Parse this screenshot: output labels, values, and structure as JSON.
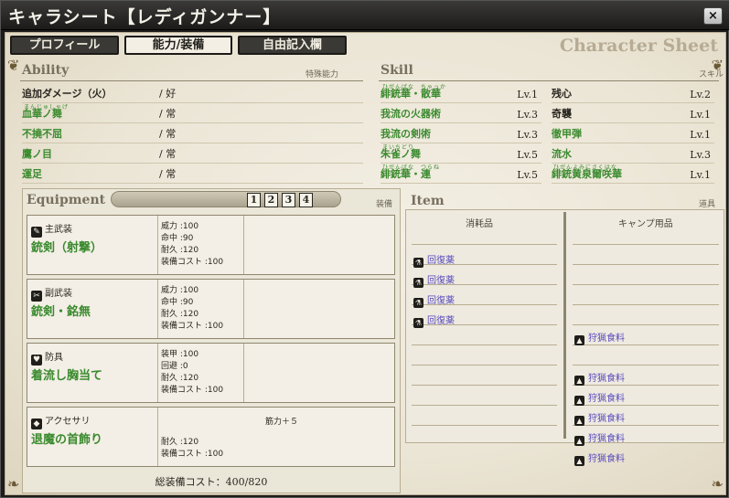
{
  "window": {
    "title": "キャラシート【レディガンナー】",
    "close": "×"
  },
  "tabs": [
    {
      "label": "プロフィール"
    },
    {
      "label": "能力/装備"
    },
    {
      "label": "自由記入欄"
    }
  ],
  "sheet_label": "Character Sheet",
  "ability": {
    "header": "Ability",
    "header_right": "特殊能力",
    "rows": [
      {
        "name": "追加ダメージ（火）",
        "ruby": "",
        "value": "/ 好"
      },
      {
        "name": "血華ノ舞",
        "ruby": "まんじゅしゃげ",
        "value": "/ 常"
      },
      {
        "name": "不撓不屈",
        "ruby": "",
        "value": "/ 常"
      },
      {
        "name": "鷹ノ目",
        "ruby": "",
        "value": "/ 常"
      },
      {
        "name": "運足",
        "ruby": "",
        "value": "/ 常"
      }
    ]
  },
  "skill": {
    "header": "Skill",
    "header_right": "スキル",
    "rows": [
      {
        "left": {
          "name": "緋銃華・散華",
          "ruby": "ひがんばな　ちゃっか",
          "lv": "Lv.1"
        },
        "right": {
          "name": "残心",
          "ruby": "",
          "lv": "Lv.2"
        }
      },
      {
        "left": {
          "name": "我流の火器術",
          "ruby": "",
          "lv": "Lv.3"
        },
        "right": {
          "name": "奇襲",
          "ruby": "",
          "lv": "Lv.1"
        }
      },
      {
        "left": {
          "name": "我流の剣術",
          "ruby": "",
          "lv": "Lv.3"
        },
        "right": {
          "name": "徹甲弾",
          "ruby": "",
          "lv": "Lv.1"
        }
      },
      {
        "left": {
          "name": "朱雀ノ舞",
          "ruby": "まいちどり",
          "lv": "Lv.5"
        },
        "right": {
          "name": "流水",
          "ruby": "",
          "lv": "Lv.3"
        }
      },
      {
        "left": {
          "name": "緋銃華・連",
          "ruby": "ひがんばな　つらね",
          "lv": "Lv.5"
        },
        "right": {
          "name": "緋銃黄泉爾咲華",
          "ruby": "ひがんよみにさくはな",
          "lv": "Lv.1"
        }
      }
    ]
  },
  "equipment": {
    "header": "Equipment",
    "header_right": "装備",
    "sets": [
      "1",
      "2",
      "3",
      "4"
    ],
    "total_label": "総装備コスト：",
    "total_value": "400/820",
    "items": [
      {
        "category": "主武装",
        "name": "銃剣（射撃）",
        "stats": [
          "威力 :100",
          "命中 :90",
          "耐久 :120",
          "装備コスト :100"
        ],
        "bonus": ""
      },
      {
        "category": "副武装",
        "name": "銃剣・銘無",
        "stats": [
          "威力 :100",
          "命中 :90",
          "耐久 :120",
          "装備コスト :100"
        ],
        "bonus": ""
      },
      {
        "category": "防具",
        "name": "着流し胸当て",
        "stats": [
          "装甲 :100",
          "回避 :0",
          "耐久 :120",
          "装備コスト :100"
        ],
        "bonus": ""
      },
      {
        "category": "アクセサリ",
        "name": "退魔の首飾り",
        "stats": [
          "",
          "",
          "耐久 :120",
          "装備コスト :100"
        ],
        "bonus": "筋力＋５"
      }
    ]
  },
  "item": {
    "header": "Item",
    "header_right": "道具",
    "consumables": {
      "header": "消耗品",
      "entries": [
        "回復薬",
        "回復薬",
        "回復薬",
        "回復薬"
      ]
    },
    "camp": {
      "header": "キャンプ用品",
      "entries": [
        "狩猟食料",
        "狩猟食料",
        "狩猟食料",
        "狩猟食料",
        "狩猟食料",
        "狩猟食料"
      ]
    }
  },
  "colors": {
    "accent_green": "#3a8a2e",
    "link_purple": "#5a4bbf",
    "title_bg": "#1c1b19"
  }
}
